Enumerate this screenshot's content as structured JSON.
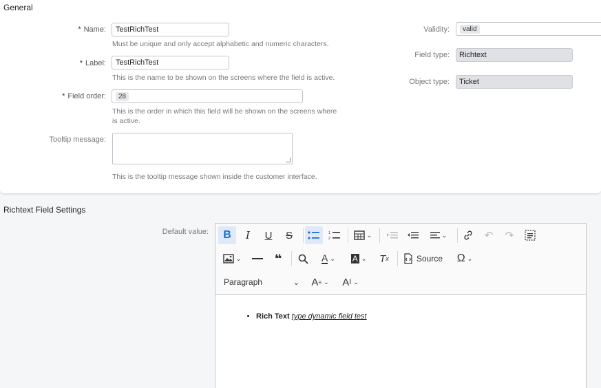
{
  "general": {
    "section_title": "General",
    "name": {
      "label": "Name:",
      "value": "TestRichTest",
      "help": "Must be unique and only accept alphabetic and numeric characters."
    },
    "label_field": {
      "label": "Label:",
      "value": "TestRichTest",
      "help": "This is the name to be shown on the screens where the field is active."
    },
    "field_order": {
      "label": "Field order:",
      "value": "28",
      "help_line1": "This is the order in which this field will be shown on the screens where",
      "help_line2": "is active."
    },
    "tooltip": {
      "label": "Tooltip message:",
      "value": "",
      "help": "This is the tooltip message shown inside the customer interface."
    },
    "required_marker": "*",
    "validity": {
      "label": "Validity:",
      "value": "valid"
    },
    "field_type": {
      "label": "Field type:",
      "value": "Richtext"
    },
    "object_type": {
      "label": "Object type:",
      "value": "Ticket"
    }
  },
  "richtext": {
    "section_title": "Richtext Field Settings",
    "default_value_label": "Default value:",
    "toolbar": {
      "source_label": "Source",
      "paragraph_label": "Paragraph",
      "icons": [
        "bold-icon",
        "italic-icon",
        "underline-icon",
        "strikethrough-icon",
        "bulleted-list-icon",
        "numbered-list-icon",
        "table-icon",
        "outdent-icon",
        "indent-icon",
        "align-icon",
        "link-icon",
        "undo-icon",
        "redo-icon",
        "select-all-icon",
        "image-icon",
        "horizontal-line-icon",
        "quote-icon",
        "find-replace-icon",
        "font-color-icon",
        "background-color-icon",
        "remove-format-icon",
        "source-icon",
        "special-chars-icon",
        "font-family-icon",
        "font-size-icon"
      ]
    },
    "content": {
      "bold_text": "Rich Text",
      "link_text": "type dynamic field test"
    }
  },
  "colors": {
    "active_blue": "#1f6fd0",
    "active_bg": "#dfe9f7",
    "page_bg": "#f5f6f7"
  }
}
